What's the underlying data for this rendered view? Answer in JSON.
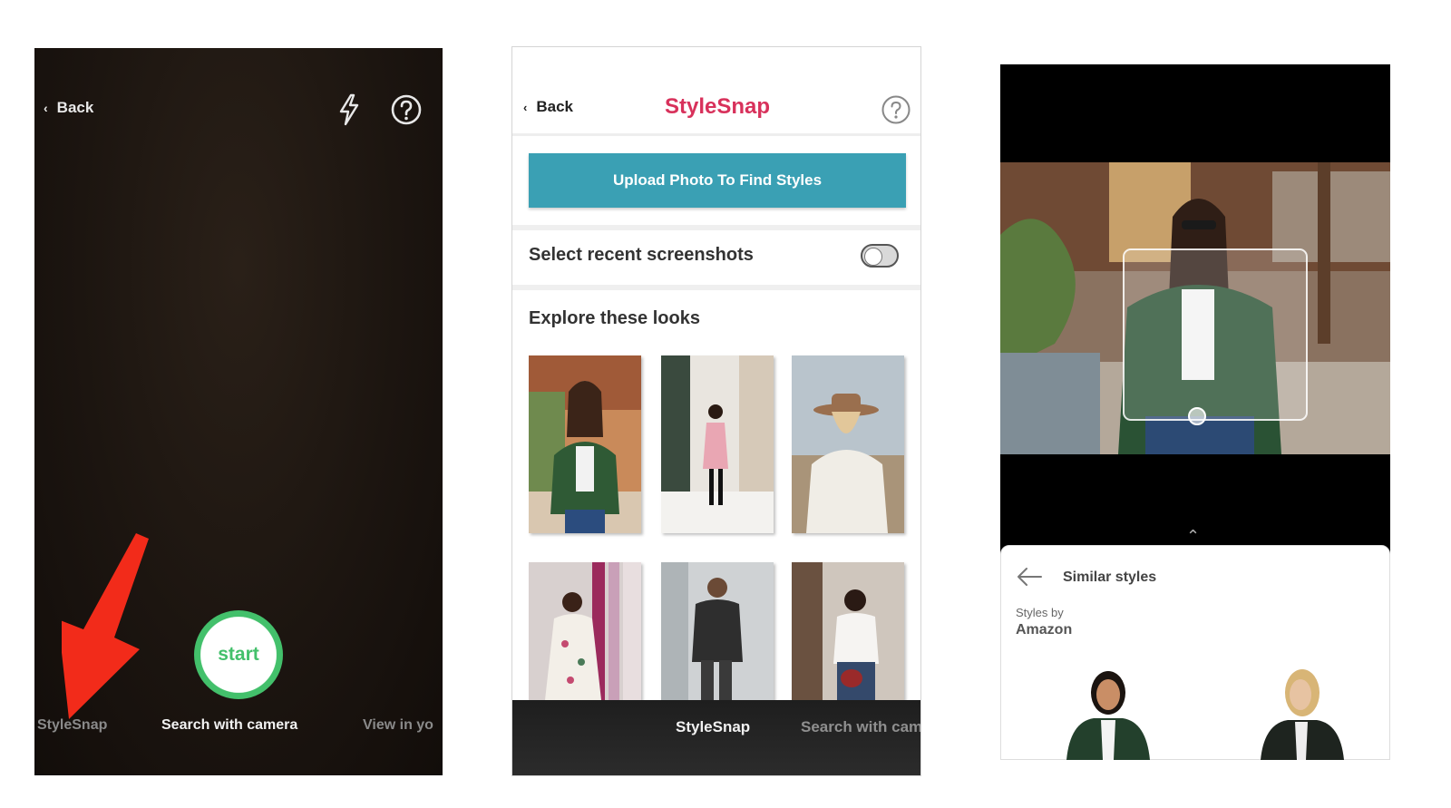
{
  "screen1": {
    "back_label": "Back",
    "start_label": "start",
    "modes": [
      "StyleSnap",
      "Search with camera",
      "View in yo"
    ]
  },
  "screen2": {
    "back_label": "Back",
    "title": "StyleSnap",
    "upload_button": "Upload Photo To Find Styles",
    "screenshots_label": "Select recent screenshots",
    "screenshots_toggle_on": false,
    "explore_heading": "Explore these looks",
    "looks_count_visible": 6,
    "bottom_nav": [
      "StyleSnap",
      "Search with cam"
    ]
  },
  "screen3": {
    "sheet_title": "Similar styles",
    "styles_by": "Styles by",
    "brand": "Amazon"
  },
  "colors": {
    "stylesnap_title": "#d8315b",
    "upload_button_bg": "#3aa0b4",
    "start_ring": "#43c06b",
    "arrow_red": "#f22b1a"
  },
  "icons": [
    "chevron-left-icon",
    "flash-icon",
    "help-icon",
    "arrow-left-icon",
    "chevron-up-icon"
  ]
}
